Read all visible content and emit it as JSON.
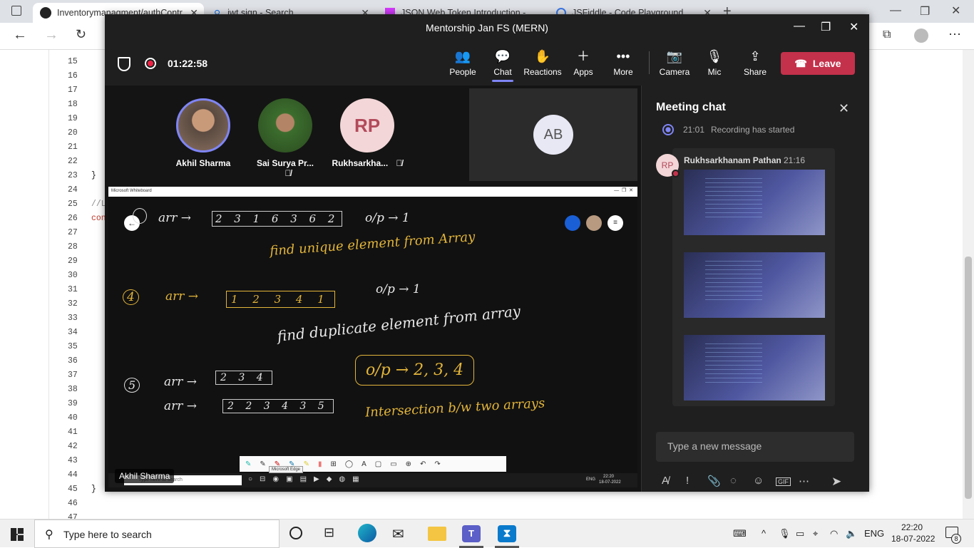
{
  "browser": {
    "tabs": [
      {
        "label": "Inventorymanagment/authContr",
        "icon": "github-icon"
      },
      {
        "label": "jwt.sign - Search",
        "icon": "search-icon"
      },
      {
        "label": "JSON Web Token Introduction -",
        "icon": "jwt-icon"
      },
      {
        "label": "JSFiddle - Code Playground",
        "icon": "jsfiddle-icon"
      }
    ]
  },
  "editor": {
    "line_numbers": [
      "15",
      "16",
      "17",
      "18",
      "19",
      "20",
      "21",
      "22",
      "23",
      "24",
      "25",
      "26",
      "27",
      "28",
      "29",
      "30",
      "31",
      "32",
      "33",
      "34",
      "35",
      "36",
      "37",
      "38",
      "39",
      "40",
      "41",
      "42",
      "43",
      "44",
      "45",
      "46",
      "47"
    ],
    "brace_23": "}",
    "comment_25": "//L",
    "code_26": "con",
    "brace_45": "}"
  },
  "teams": {
    "window_title": "Mentorship Jan FS (MERN)",
    "timer": "01:22:58",
    "toolbar": {
      "people": "People",
      "chat": "Chat",
      "reactions": "Reactions",
      "apps": "Apps",
      "more": "More",
      "camera": "Camera",
      "mic": "Mic",
      "share": "Share",
      "leave": "Leave"
    },
    "participants": [
      {
        "name": "Akhil Sharma"
      },
      {
        "name": "Sai Surya Pr..."
      },
      {
        "name": "Rukhsarkha...",
        "initials": "RP"
      }
    ],
    "ab_tile": "AB",
    "presenter_name": "Akhil Sharma",
    "whiteboard": {
      "window_title": "Microsoft Whiteboard",
      "ink": {
        "q3_arr": "arr →",
        "q3_array": "2 3 1 6 3 6 2",
        "q3_op": "o/p → 1",
        "q3_task": "find unique element from Array",
        "q4_num": "4",
        "q4_arr": "arr →",
        "q4_array": "1 2 3 4 1",
        "q4_op": "o/p → 1",
        "q4_task": "find duplicate element from array",
        "q5_num": "5",
        "q5_arr1": "arr →",
        "q5_array1": "2 3 4",
        "q5_arr2": "arr →",
        "q5_array2": "2 2 3 4 3 5",
        "q5_op": "o/p → 2, 3, 4",
        "q5_task": "Intersection b/w two arrays"
      },
      "inner_taskbar": {
        "search": "Type here to search",
        "time": "22:20",
        "date": "18-07-2022",
        "lang": "ENG",
        "tooltip": "Microsoft Edge"
      }
    },
    "chat": {
      "title": "Meeting chat",
      "system_time": "21:01",
      "system_msg": "Recording has started",
      "sender": "Rukhsarkhanam Pathan",
      "sender_initials": "RP",
      "sender_time": "21:16",
      "input_placeholder": "Type a new message"
    }
  },
  "taskbar": {
    "search_placeholder": "Type here to search",
    "lang": "ENG",
    "time": "22:20",
    "date": "18-07-2022",
    "notifications": "8"
  },
  "colors": {
    "leave": "#c4314b",
    "accent": "#7f85f5",
    "ink_yellow": "#e3b53a",
    "ink_white": "#e8e8e8"
  }
}
